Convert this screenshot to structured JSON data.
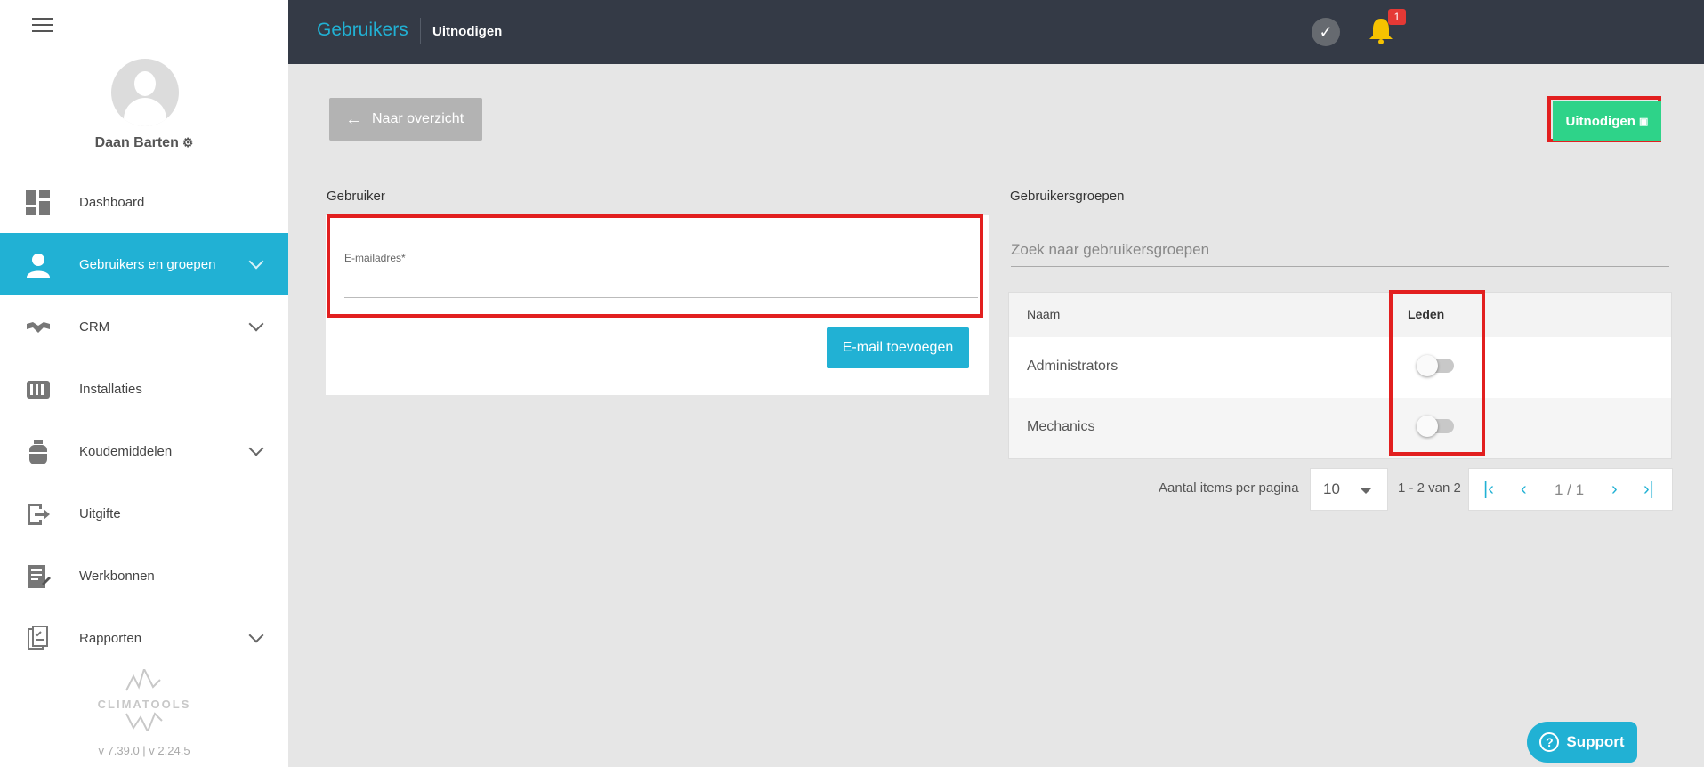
{
  "sidebar": {
    "user_name": "Daan Barten",
    "items": [
      {
        "label": "Dashboard",
        "icon": "dashboard-icon"
      },
      {
        "label": "Gebruikers en groepen",
        "icon": "user-icon"
      },
      {
        "label": "CRM",
        "icon": "handshake-icon"
      },
      {
        "label": "Installaties",
        "icon": "installation-icon"
      },
      {
        "label": "Koudemiddelen",
        "icon": "gas-cylinder-icon"
      },
      {
        "label": "Uitgifte",
        "icon": "export-icon"
      },
      {
        "label": "Werkbonnen",
        "icon": "work-order-icon"
      },
      {
        "label": "Rapporten",
        "icon": "report-icon"
      }
    ],
    "logo_text": "CLIMATOOLS",
    "version": "v 7.39.0  | v 2.24.5"
  },
  "header": {
    "title": "Gebruikers",
    "subtitle": "Uitnodigen",
    "notification_count": "1"
  },
  "actions": {
    "back_label": "Naar overzicht",
    "invite_label": "Uitnodigen"
  },
  "user_form": {
    "section_label": "Gebruiker",
    "email_label": "E-mailadres*",
    "email_value": "",
    "add_email_label": "E-mail toevoegen"
  },
  "groups": {
    "section_label": "Gebruikersgroepen",
    "search_placeholder": "Zoek naar gebruikersgroepen",
    "columns": {
      "name": "Naam",
      "members": "Leden"
    },
    "rows": [
      {
        "name": "Administrators",
        "member": false
      },
      {
        "name": "Mechanics",
        "member": false
      }
    ]
  },
  "pagination": {
    "per_page_label": "Aantal items per pagina",
    "per_page_value": "10",
    "range": "1 - 2 van 2",
    "page_info": "1 / 1"
  },
  "support": {
    "label": "Support"
  },
  "colors": {
    "accent": "#21b1d4",
    "success": "#2ed389",
    "topbar": "#343a46",
    "highlight": "#e21f1f"
  }
}
